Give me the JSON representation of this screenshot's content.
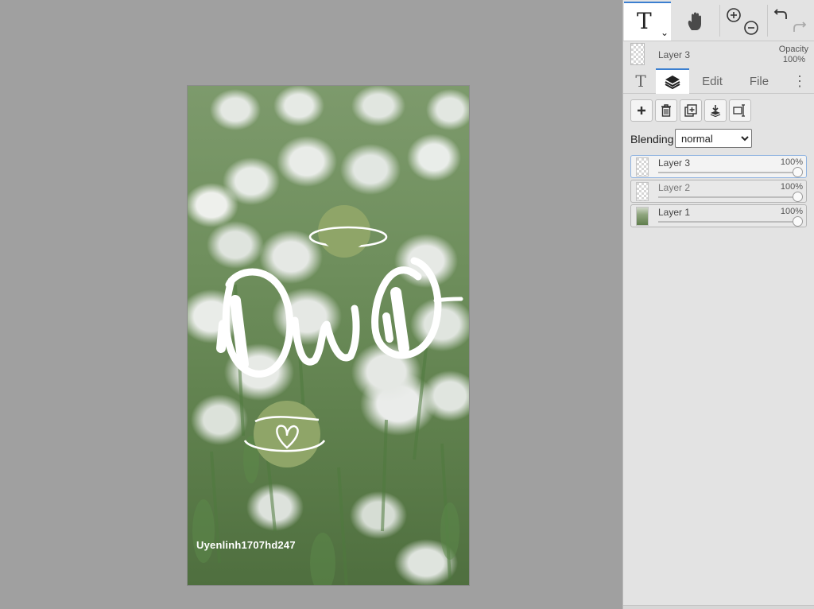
{
  "canvas": {
    "watermark": "Uyenlinh1707hd247",
    "accent_circle_color": "#8fa568"
  },
  "toolbar": {
    "text_tool_glyph": "T",
    "text_tool_dropdown": "⌄",
    "icons": [
      "text-tool-icon",
      "hand-tool-icon",
      "zoom-in-icon",
      "zoom-out-icon",
      "undo-icon",
      "redo-icon"
    ],
    "active_color": "#3b7fd0"
  },
  "layer_info": {
    "name": "Layer 3",
    "opacity_label": "Opacity",
    "opacity_value": "100%"
  },
  "tabs": {
    "text_glyph": "T",
    "edit": "Edit",
    "file": "File",
    "more": "⋮"
  },
  "layer_actions": [
    "add-layer",
    "delete-layer",
    "duplicate-layer",
    "merge-down",
    "layer-properties"
  ],
  "blending": {
    "label": "Blending",
    "value": "normal",
    "options": [
      "normal"
    ]
  },
  "layers": [
    {
      "name": "Layer 3",
      "opacity": "100%",
      "opacity_value": 1.0
    },
    {
      "name": "Layer 2",
      "opacity": "100%",
      "opacity_value": 1.0
    },
    {
      "name": "Layer 1",
      "opacity": "100%",
      "opacity_value": 1.0
    }
  ]
}
